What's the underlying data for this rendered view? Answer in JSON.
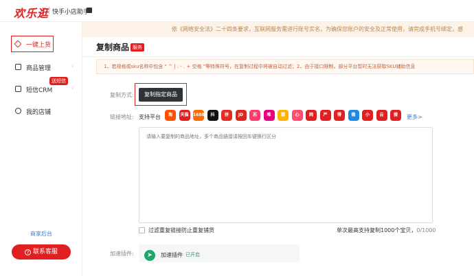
{
  "header": {
    "logo": "欢乐逛",
    "app_name": "快手小店助手"
  },
  "sidebar": {
    "items": [
      {
        "label": "一键上货",
        "icon": "tag-icon",
        "active": true
      },
      {
        "label": "商品管理",
        "icon": "box-icon"
      },
      {
        "label": "短信CRM",
        "icon": "mail-icon",
        "badge": "送短信"
      },
      {
        "label": "我的店铺",
        "icon": "shop-icon"
      }
    ],
    "merchant_link": "商家后台",
    "service_button": "联系客服"
  },
  "notice": "依《网络安全法》二十四条要求，互联网服务需进行账号实名，为确保您账户的安全及正常使用，请完成手机号绑定，感",
  "page": {
    "title": "复制商品",
    "title_tag": "服务",
    "tip": "1、若规格或sku名称中包含 \" ^ | : - . + 空格 \"等特殊符号，在复制过程中将被自动过滤；2、由于接口限制，部分平台暂时无法获取SKU辅助信息"
  },
  "form": {
    "method_label": "复制方式:",
    "method_button": "复制指定商品",
    "link_label": "链接地址:",
    "platform_label": "支持平台",
    "platforms": [
      {
        "name": "淘",
        "color": "#ff5000"
      },
      {
        "name": "天猫",
        "color": "#e02020"
      },
      {
        "name": "1688",
        "color": "#ff6a00"
      },
      {
        "name": "抖",
        "color": "#111111"
      },
      {
        "name": "拼",
        "color": "#e02e24"
      },
      {
        "name": "JD",
        "color": "#e1251b"
      },
      {
        "name": "苏",
        "color": "#ff3a6e"
      },
      {
        "name": "唯",
        "color": "#e6007e"
      },
      {
        "name": "蘑",
        "color": "#ffb300"
      },
      {
        "name": "心",
        "color": "#ff4d6d"
      },
      {
        "name": "网",
        "color": "#e02020"
      },
      {
        "name": "严",
        "color": "#e02020"
      },
      {
        "name": "得",
        "color": "#e02020"
      },
      {
        "name": "微",
        "color": "#1e88e5"
      },
      {
        "name": "小",
        "color": "#e02020"
      },
      {
        "name": "云",
        "color": "#e02020"
      },
      {
        "name": "搜",
        "color": "#e02020"
      }
    ],
    "more_link": "更多>",
    "textarea_placeholder": "请输入要复制的商品地址，多个商品链接请按回车键换行区分",
    "dedupe_label": "过滤重复链接防止重复铺货",
    "limit_text": "单次最高支持复制1000个宝贝，",
    "limit_count": "0/1000",
    "plugin_label": "加速插件:",
    "plugin_name": "加速插件",
    "plugin_status": "已开启"
  }
}
